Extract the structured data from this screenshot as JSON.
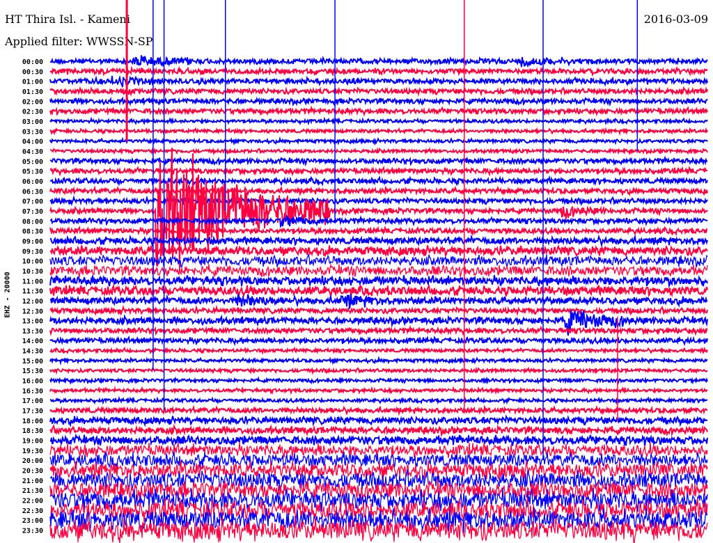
{
  "header": {
    "station": "HT Thira Isl. - Kameni",
    "filter": "Applied filter: WWSSN-SP",
    "date": "2016-03-09"
  },
  "chart_data": {
    "type": "line",
    "title": "HT Thira Isl. - Kameni",
    "ylabel": "EHZ - 20000",
    "minutes_per_row": 30,
    "row_labels": [
      "00:00",
      "00:30",
      "01:00",
      "01:30",
      "02:00",
      "02:30",
      "03:00",
      "03:30",
      "04:00",
      "04:30",
      "05:00",
      "05:30",
      "06:00",
      "06:30",
      "07:00",
      "07:30",
      "08:00",
      "08:30",
      "09:00",
      "09:30",
      "10:00",
      "10:30",
      "11:00",
      "11:30",
      "12:00",
      "12:30",
      "13:00",
      "13:30",
      "14:00",
      "14:30",
      "15:00",
      "15:30",
      "16:00",
      "16:30",
      "17:00",
      "17:30",
      "18:00",
      "18:30",
      "19:00",
      "19:30",
      "20:00",
      "20:30",
      "21:00",
      "21:30",
      "22:00",
      "22:30",
      "23:00",
      "23:30"
    ],
    "row_colors": [
      "#0000ff",
      "#ff0040"
    ],
    "relative_amplitude": [
      3,
      3,
      3,
      3,
      3,
      3,
      2,
      2,
      2,
      2,
      3,
      3,
      3,
      3,
      3,
      3,
      3,
      3,
      4,
      5,
      6,
      6,
      5,
      5,
      4,
      3,
      4,
      3,
      3,
      2,
      2,
      2,
      2,
      2,
      2,
      3,
      4,
      4,
      5,
      7,
      8,
      9,
      10,
      10,
      11,
      11,
      12,
      12
    ],
    "events": [
      {
        "row": 0,
        "minute": 3.8,
        "amplitude": 6,
        "duration": 1.5
      },
      {
        "row": 0,
        "minute": 21.5,
        "amplitude": 5,
        "duration": 1
      },
      {
        "row": 2,
        "minute": 2.8,
        "amplitude": 5,
        "duration": 1
      },
      {
        "row": 15,
        "minute": 4.8,
        "amplitude": 80,
        "duration": 4
      },
      {
        "row": 15,
        "minute": 23.3,
        "amplitude": 6,
        "duration": 1
      },
      {
        "row": 16,
        "minute": 10.5,
        "amplitude": 5,
        "duration": 1
      },
      {
        "row": 24,
        "minute": 13.2,
        "amplitude": 7,
        "duration": 1
      },
      {
        "row": 24,
        "minute": 8.5,
        "amplitude": 6,
        "duration": 1
      },
      {
        "row": 26,
        "minute": 23.5,
        "amplitude": 14,
        "duration": 1.5
      }
    ],
    "spikes": [
      {
        "row": 0,
        "minute": 3.5,
        "rows_span": 8,
        "color": "#ff0040"
      },
      {
        "row": 0,
        "minute": 4.7,
        "rows_span": 31,
        "color": "#0000ff"
      },
      {
        "row": 0,
        "minute": 5.2,
        "rows_span": 35,
        "color": "#0000ff"
      },
      {
        "row": 0,
        "minute": 8.0,
        "rows_span": 15,
        "color": "#0000ff"
      },
      {
        "row": 0,
        "minute": 13.0,
        "rows_span": 16,
        "color": "#0000ff"
      },
      {
        "row": 0,
        "minute": 18.9,
        "rows_span": 35,
        "color": "#ff0040"
      },
      {
        "row": 0,
        "minute": 22.5,
        "rows_span": 40,
        "color": "#0000ff"
      },
      {
        "row": 0,
        "minute": 26.8,
        "rows_span": 9,
        "color": "#0000ff"
      },
      {
        "row": 27,
        "minute": 25.9,
        "rows_span": 9,
        "color": "#ff0040"
      }
    ]
  }
}
